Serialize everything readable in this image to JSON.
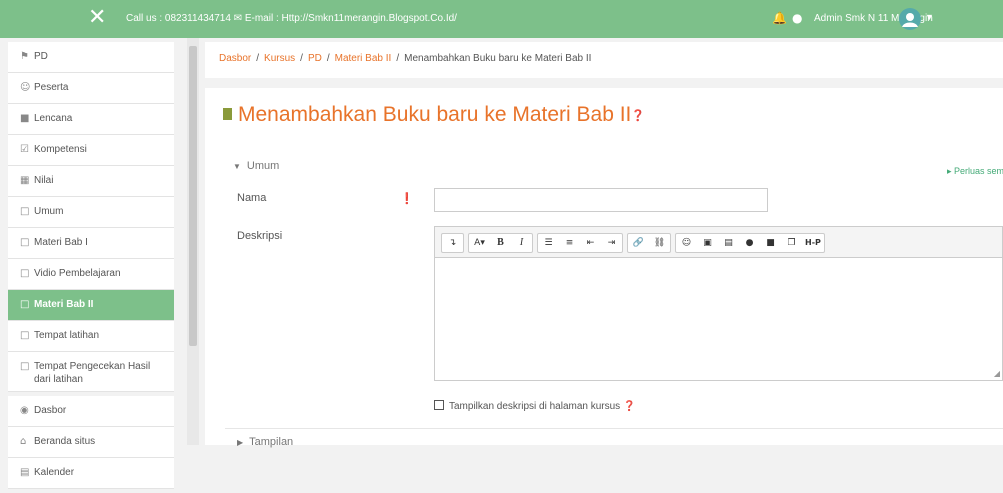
{
  "topbar": {
    "contact": "Call us : 082311434714 ✉ E-mail : Http://Smkn11merangin.Blogspot.Co.Id/",
    "user_name": "Admin Smk N 11 Merangin",
    "close_icon": "✕",
    "bell_icon": "🔔",
    "chat_icon": "●",
    "caret_icon": "▼"
  },
  "sidebar": {
    "groups": [
      {
        "items": [
          {
            "icon": "graduation-cap-icon",
            "glyph": "⚑",
            "label": "PD"
          },
          {
            "icon": "users-icon",
            "glyph": "☺",
            "label": "Peserta"
          },
          {
            "icon": "shield-icon",
            "glyph": "■",
            "label": "Lencana"
          },
          {
            "icon": "check-square-icon",
            "glyph": "☑",
            "label": "Kompetensi"
          },
          {
            "icon": "table-icon",
            "glyph": "▦",
            "label": "Nilai"
          },
          {
            "icon": "folder-icon",
            "glyph": "□",
            "label": "Umum"
          },
          {
            "icon": "folder-icon",
            "glyph": "□",
            "label": "Materi Bab I"
          },
          {
            "icon": "folder-icon",
            "glyph": "□",
            "label": "Vidio Pembelajaran"
          },
          {
            "icon": "folder-icon",
            "glyph": "□",
            "label": "Materi Bab II"
          },
          {
            "icon": "folder-icon",
            "glyph": "□",
            "label": "Tempat latihan"
          },
          {
            "icon": "folder-icon",
            "glyph": "□",
            "label": "Tempat Pengecekan Hasil dari latihan"
          }
        ]
      },
      {
        "items": [
          {
            "icon": "dashboard-icon",
            "glyph": "◉",
            "label": "Dasbor"
          },
          {
            "icon": "home-icon",
            "glyph": "⌂",
            "label": "Beranda situs"
          },
          {
            "icon": "calendar-icon",
            "glyph": "▤",
            "label": "Kalender"
          }
        ]
      }
    ],
    "active_index": 8
  },
  "breadcrumb": {
    "items": [
      "Dasbor",
      "Kursus",
      "PD",
      "Materi Bab II"
    ],
    "current": "Menambahkan Buku baru ke Materi Bab II",
    "separator": "/"
  },
  "page": {
    "title": "Menambahkan Buku baru ke Materi Bab II",
    "help_icon": "❓",
    "expand_all": "Perluas semua",
    "section_general": "Umum",
    "section_display": "Tampilan"
  },
  "form": {
    "name_label": "Nama",
    "name_value": "",
    "required_icon": "❗",
    "desc_label": "Deskripsi",
    "desc_value": "",
    "show_desc_label": "Tampilkan deskripsi di halaman kursus",
    "show_desc_checked": false
  },
  "editor_toolbar": {
    "groups": [
      [
        "↴"
      ],
      [
        "A▾",
        "B",
        "I"
      ],
      [
        "☰",
        "≡",
        "⇤",
        "⇥"
      ],
      [
        "🔗",
        "⛓"
      ],
      [
        "☺",
        "▣",
        "▤",
        "●",
        "■",
        "❐",
        "H-P"
      ]
    ]
  },
  "colors": {
    "accent_green": "#7dc08a",
    "link_orange": "#e8732a"
  }
}
